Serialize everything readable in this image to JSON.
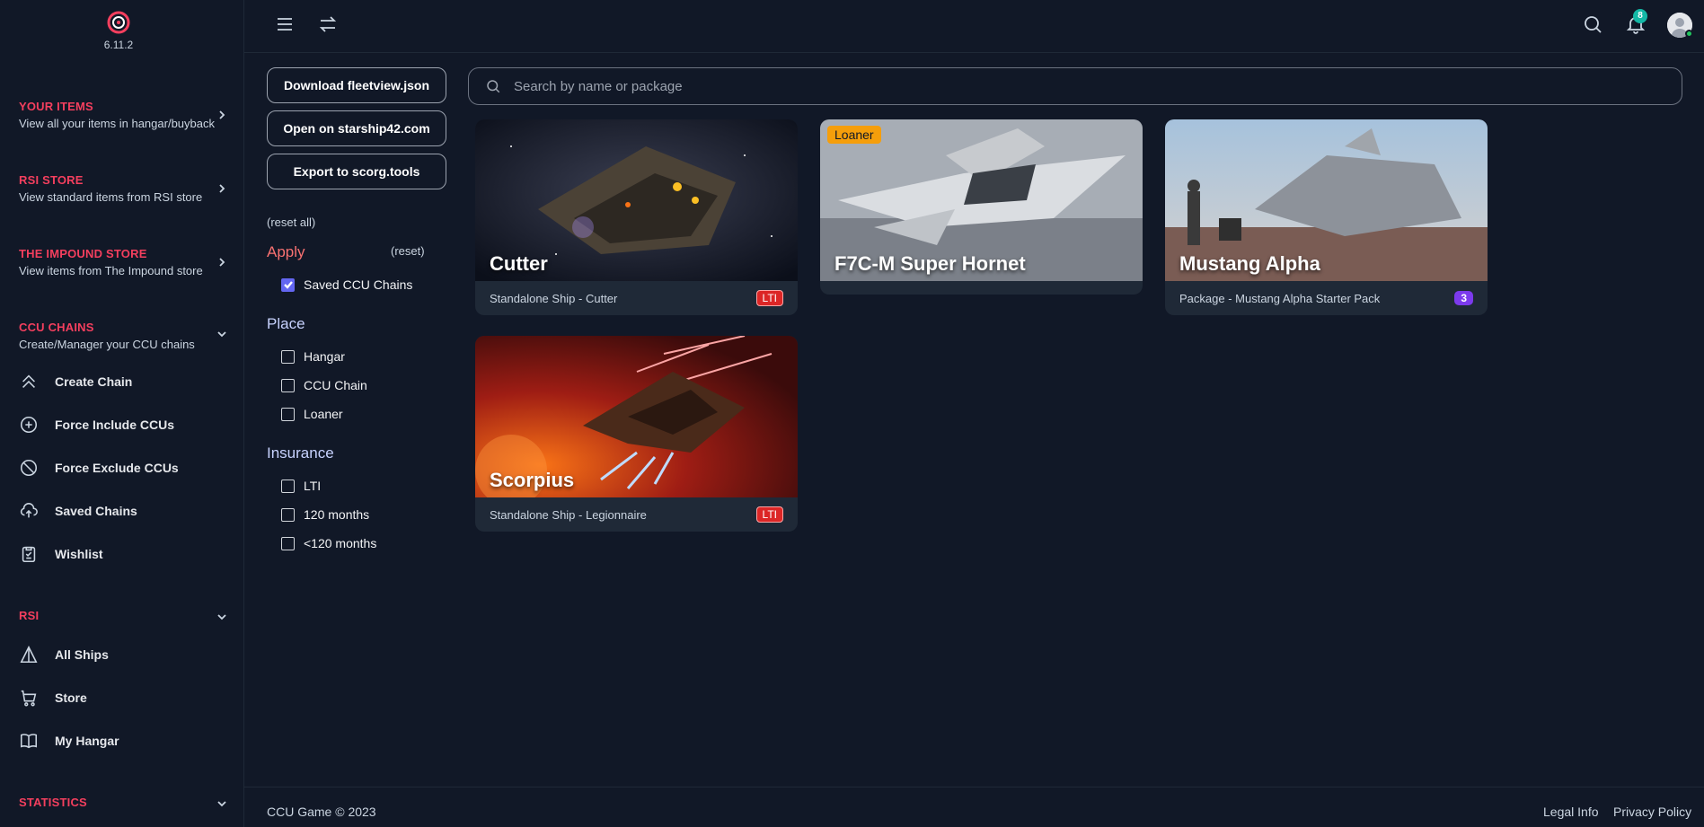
{
  "app": {
    "version": "6.11.2",
    "notification_count": "8"
  },
  "sidebar": {
    "sections": [
      {
        "title": "YOUR ITEMS",
        "subtitle": "View all your items in hangar/buyback"
      },
      {
        "title": "RSI STORE",
        "subtitle": "View standard items from RSI store"
      },
      {
        "title": "THE IMPOUND STORE",
        "subtitle": "View items from The Impound store"
      },
      {
        "title": "CCU CHAINS",
        "subtitle": "Create/Manager your CCU chains"
      },
      {
        "title": "RSI",
        "subtitle": ""
      },
      {
        "title": "STATISTICS",
        "subtitle": ""
      }
    ],
    "ccu_items": [
      {
        "label": "Create Chain",
        "icon": "chevrons-up-icon"
      },
      {
        "label": "Force Include CCUs",
        "icon": "plus-circle-icon"
      },
      {
        "label": "Force Exclude CCUs",
        "icon": "ban-icon"
      },
      {
        "label": "Saved Chains",
        "icon": "cloud-upload-icon"
      },
      {
        "label": "Wishlist",
        "icon": "clipboard-icon"
      }
    ],
    "rsi_items": [
      {
        "label": "All Ships",
        "icon": "triangle-icon"
      },
      {
        "label": "Store",
        "icon": "cart-icon"
      },
      {
        "label": "My Hangar",
        "icon": "book-icon"
      }
    ]
  },
  "actions": {
    "download": "Download fleetview.json",
    "starship42": "Open on starship42.com",
    "scorg": "Export to scorg.tools"
  },
  "filters": {
    "reset_all": "(reset all)",
    "apply_title": "Apply",
    "reset": "(reset)",
    "apply_options": [
      {
        "label": "Saved CCU Chains",
        "checked": true
      }
    ],
    "place_title": "Place",
    "place_options": [
      {
        "label": "Hangar"
      },
      {
        "label": "CCU Chain"
      },
      {
        "label": "Loaner"
      }
    ],
    "insurance_title": "Insurance",
    "insurance_options": [
      {
        "label": "LTI"
      },
      {
        "label": "120 months"
      },
      {
        "label": "<120 months"
      }
    ]
  },
  "search": {
    "placeholder": "Search by name or package",
    "value": ""
  },
  "cards": [
    {
      "name": "Cutter",
      "subtitle": "Standalone Ship - Cutter",
      "badge": "LTI"
    },
    {
      "name": "F7C-M Super Hornet",
      "subtitle": "",
      "tag": "Loaner"
    },
    {
      "name": "Mustang Alpha",
      "subtitle": "Package - Mustang Alpha Starter Pack",
      "badge": "3"
    },
    {
      "name": "Scorpius",
      "subtitle": "Standalone Ship - Legionnaire",
      "badge": "LTI"
    }
  ],
  "footer": {
    "copyright": "CCU Game © 2023",
    "legal": "Legal Info",
    "privacy": "Privacy Policy"
  },
  "colors": {
    "accent": "#f43f5e",
    "checkbox": "#6366f1",
    "lti": "#dc2626",
    "count": "#7c3aed",
    "loaner": "#f59e0b",
    "bg": "#111827"
  }
}
